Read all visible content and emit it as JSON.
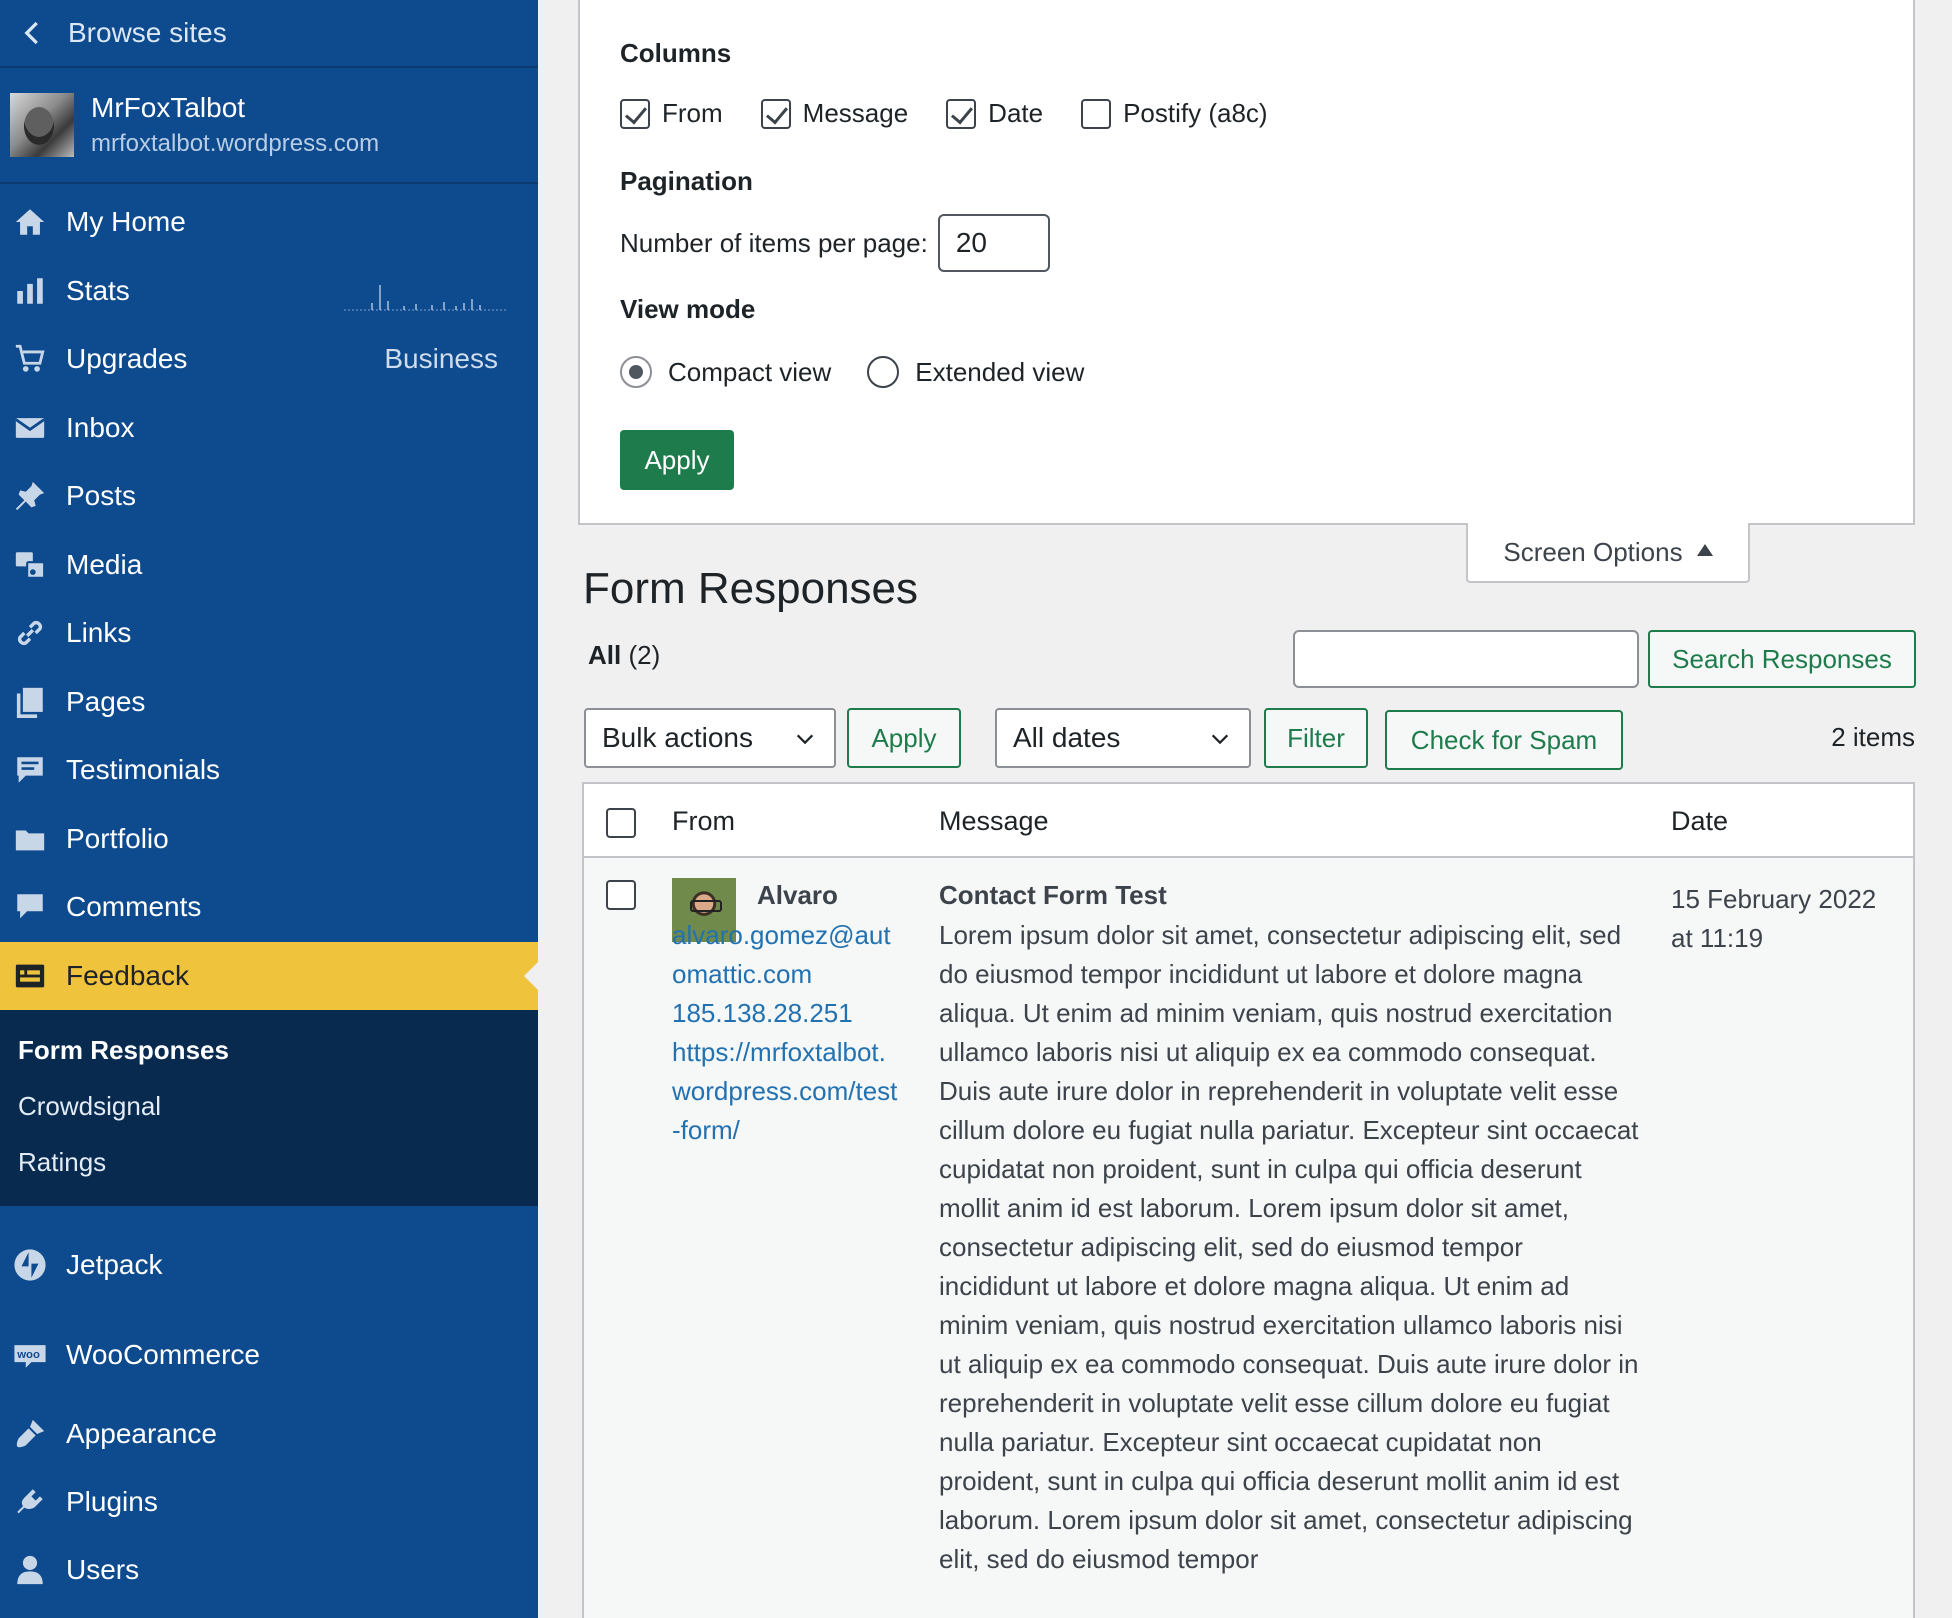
{
  "sidebar": {
    "browse_label": "Browse sites",
    "site_name": "MrFoxTalbot",
    "site_url": "mrfoxtalbot.wordpress.com",
    "items": [
      {
        "label": "My Home"
      },
      {
        "label": "Stats"
      },
      {
        "label": "Upgrades",
        "extra": "Business"
      },
      {
        "label": "Inbox"
      },
      {
        "label": "Posts"
      },
      {
        "label": "Media"
      },
      {
        "label": "Links"
      },
      {
        "label": "Pages"
      },
      {
        "label": "Testimonials"
      },
      {
        "label": "Portfolio"
      },
      {
        "label": "Comments"
      },
      {
        "label": "Feedback"
      }
    ],
    "submenu": [
      "Form Responses",
      "Crowdsignal",
      "Ratings"
    ],
    "lower_items": [
      {
        "label": "Jetpack"
      },
      {
        "label": "WooCommerce"
      },
      {
        "label": "Appearance"
      },
      {
        "label": "Plugins"
      },
      {
        "label": "Users"
      }
    ],
    "accent": "#f0c33c",
    "background": "#0e4a8e"
  },
  "screen_options": {
    "columns_heading": "Columns",
    "columns": [
      {
        "label": "From",
        "checked": true
      },
      {
        "label": "Message",
        "checked": true
      },
      {
        "label": "Date",
        "checked": true
      },
      {
        "label": "Postify (a8c)",
        "checked": false
      }
    ],
    "pagination_heading": "Pagination",
    "per_page_label": "Number of items per page:",
    "per_page_value": "20",
    "view_mode_heading": "View mode",
    "view_modes": [
      {
        "label": "Compact view",
        "selected": true
      },
      {
        "label": "Extended view",
        "selected": false
      }
    ],
    "apply_label": "Apply",
    "tab_label": "Screen Options"
  },
  "main": {
    "title": "Form Responses",
    "filter_all_label": "All",
    "filter_all_count": "(2)",
    "search_placeholder": "",
    "search_button": "Search Responses",
    "bulk_actions": "Bulk actions",
    "bulk_apply": "Apply",
    "dates_select": "All dates",
    "filter_button": "Filter",
    "spam_button": "Check for Spam",
    "items_count": "2 items",
    "brand_color": "#1e7c4c"
  },
  "table": {
    "headers": {
      "from": "From",
      "message": "Message",
      "date": "Date"
    },
    "rows": [
      {
        "name": "Alvaro",
        "email": "alvaro.gomez@automattic.com",
        "ip": "185.138.28.251",
        "url": "https://mrfoxtalbot.wordpress.com/test-form/",
        "subject": "Contact Form Test",
        "message": "Lorem ipsum dolor sit amet, consectetur adipiscing elit, sed do eiusmod tempor incididunt ut labore et dolore magna aliqua. Ut enim ad minim veniam, quis nostrud exercitation ullamco laboris nisi ut aliquip ex ea commodo consequat. Duis aute irure dolor in reprehenderit in voluptate velit esse cillum dolore eu fugiat nulla pariatur. Excepteur sint occaecat cupidatat non proident, sunt in culpa qui officia deserunt mollit anim id est laborum. Lorem ipsum dolor sit amet, consectetur adipiscing elit, sed do eiusmod tempor incididunt ut labore et dolore magna aliqua. Ut enim ad minim veniam, quis nostrud exercitation ullamco laboris nisi ut aliquip ex ea commodo consequat. Duis aute irure dolor in reprehenderit in voluptate velit esse cillum dolore eu fugiat nulla pariatur. Excepteur sint occaecat cupidatat non proident, sunt in culpa qui officia deserunt mollit anim id est laborum. Lorem ipsum dolor sit amet, consectetur adipiscing elit, sed do eiusmod tempor",
        "date": "15 February 2022 at 11:19"
      }
    ]
  }
}
